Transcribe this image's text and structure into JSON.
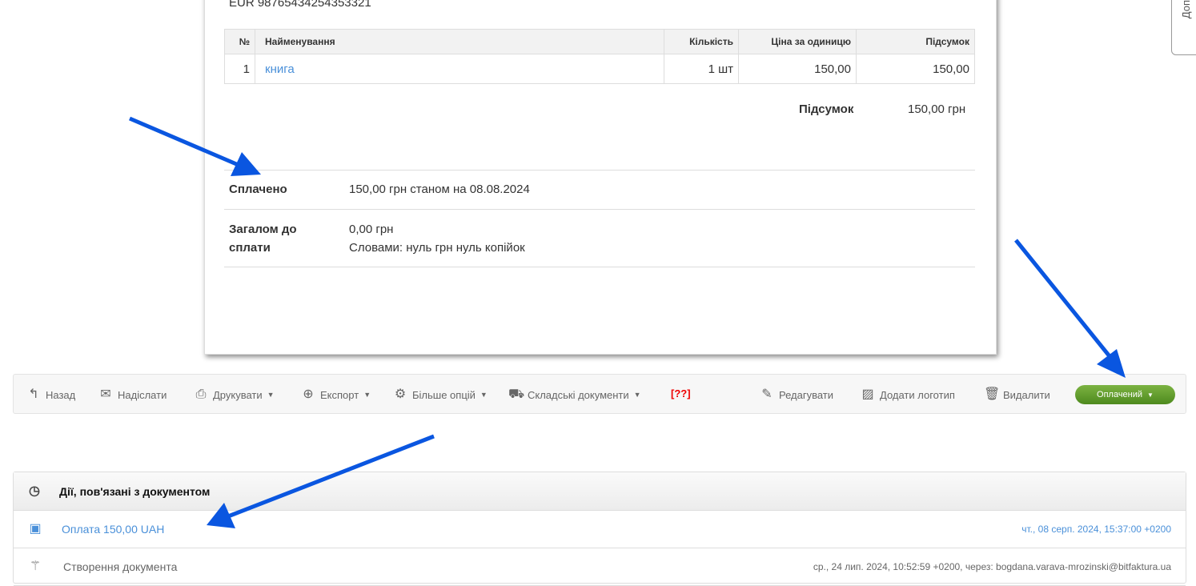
{
  "document": {
    "account": "EUR 98765434254353321",
    "table": {
      "headers": [
        "№",
        "Найменування",
        "Кількість",
        "Ціна за одиницю",
        "Підсумок"
      ],
      "rows": [
        [
          "1",
          "книга",
          "1 шт",
          "150,00",
          "150,00"
        ]
      ]
    },
    "subtotal_label": "Підсумок",
    "subtotal_value": "150,00 грн",
    "paid_label": "Сплачено",
    "paid_value": "150,00 грн станом на 08.08.2024",
    "due_label_1": "Загалом до",
    "due_label_2": "сплати",
    "due_value": "0,00 грн",
    "due_words": "Словами: нуль грн нуль копійок"
  },
  "side_tab": "Доп",
  "toolbar": {
    "back": "Назад",
    "send": "Надіслати",
    "print": "Друкувати",
    "export": "Експорт",
    "more": "Більше опцій",
    "warehouse": "Складські документи",
    "unknown": "[??]",
    "edit": "Редагувати",
    "logo": "Додати логотип",
    "delete": "Видалити",
    "status": "Оплачений"
  },
  "activity": {
    "title": "Дії, пов'язані з документом",
    "items": [
      {
        "label": "Оплата 150,00 UAH",
        "date": "чт., 08 серп. 2024, 15:37:00 +0200"
      },
      {
        "label": "Створення документа",
        "date": "ср., 24 лип. 2024, 10:52:59 +0200, через: bogdana.varava-mrozinski@bitfaktura.ua"
      }
    ]
  },
  "colors": {
    "link": "#4a90d9",
    "paid_button": "#5d9a2a",
    "arrow": "#0a56e0"
  }
}
